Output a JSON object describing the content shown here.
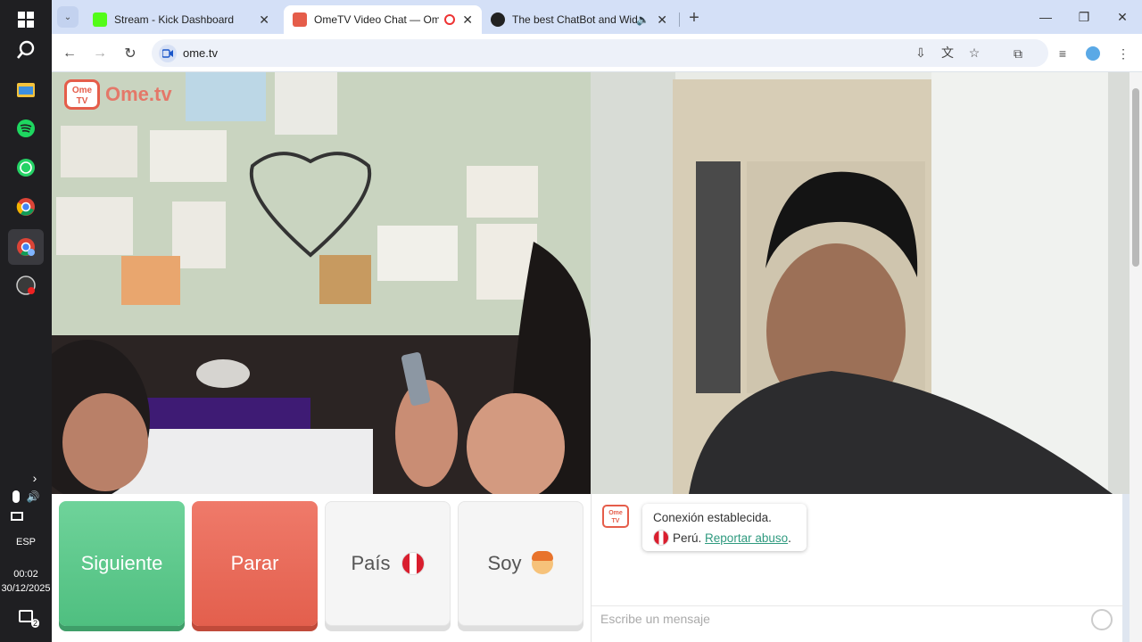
{
  "taskbar": {
    "icons": [
      "windows-start-icon",
      "search-icon",
      "file-explorer-icon",
      "spotify-icon",
      "whatsapp-icon",
      "chrome-icon",
      "chrome-profile-icon",
      "obs-icon"
    ],
    "language": "ESP",
    "time": "00:02",
    "date": "30/12/2025",
    "notification_count": "2"
  },
  "browser": {
    "tabs": [
      {
        "title": "Stream - Kick Dashboard",
        "favicon_color": "#53fc18"
      },
      {
        "title": "OmeTV Video Chat — Ome",
        "favicon_color": "#e55d4a",
        "active": true
      },
      {
        "title": "The best ChatBot and Widg",
        "favicon_color": "#222222"
      }
    ],
    "url": "ome.tv"
  },
  "app": {
    "logo_text": "Ome",
    "logo_tv": "TV",
    "watermark": "Ome.tv",
    "buttons": {
      "next": "Siguiente",
      "stop": "Parar",
      "country": "País",
      "me": "Soy"
    },
    "chat": {
      "connection_text": "Conexión establecida.",
      "country_text": "Perú.",
      "report_link": "Reportar abuso",
      "report_suffix": ".",
      "input_placeholder": "Escribe un mensaje"
    }
  },
  "colors": {
    "next_button": "#5cc98b",
    "stop_button": "#e96a58",
    "brand": "#e55d4a",
    "link": "#2f9a7f"
  }
}
